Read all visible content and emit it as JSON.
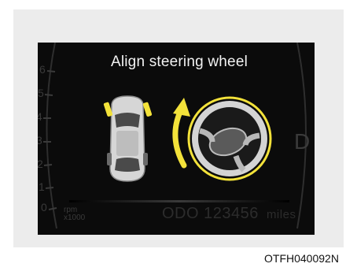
{
  "display": {
    "message": "Align steering wheel",
    "gear": "D",
    "tach_labels": [
      "6",
      "5",
      "4",
      "3",
      "2",
      "1",
      "0"
    ],
    "rpm_unit": "rpm",
    "rpm_multiplier": "x1000",
    "odometer_prefix": "ODO",
    "odometer_value": "123456",
    "odometer_unit": "miles"
  },
  "icons": [
    "car-top-view-icon",
    "rotate-arrow-icon",
    "steering-wheel-icon"
  ],
  "colors": {
    "background": "#0b0b0b",
    "message_text": "#f2f2f2",
    "indicator_yellow": "#f3e23a"
  },
  "figure_code": "OTFH040092N"
}
